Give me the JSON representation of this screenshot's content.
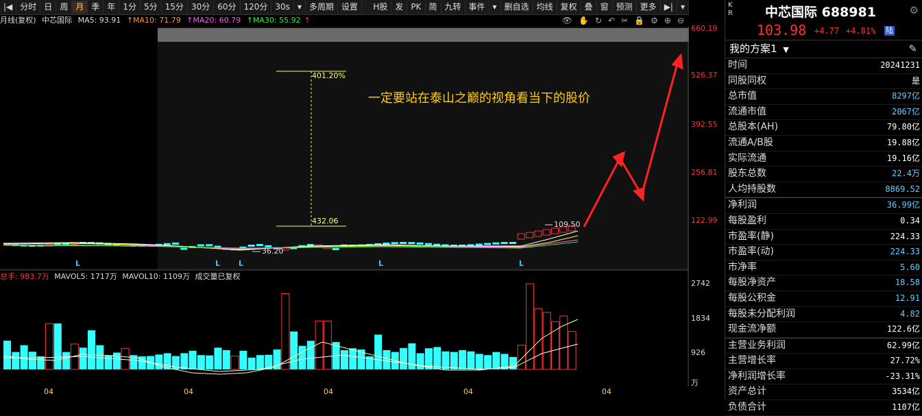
{
  "toolbar": {
    "left_items": [
      "|◀",
      "分时",
      "日",
      "周",
      "月",
      "季",
      "年",
      "1分",
      "5分",
      "15分",
      "30分",
      "60分",
      "120分",
      "30s",
      "▾",
      "多周期",
      "设置"
    ],
    "active_item": "月",
    "right_items": [
      "H股",
      "发",
      "PK",
      "简",
      "九转",
      "事件",
      "▾",
      "删自选",
      "均线",
      "复权",
      "叠",
      "窗",
      "预测",
      "更多",
      "▶|",
      "▾"
    ]
  },
  "info": {
    "period": "月线(复权)",
    "name": "中芯国际",
    "ma5": "MA5: 93.91",
    "ma10": "↑MA10: 71.79",
    "ma20": "↑MA20: 60.79",
    "ma30": "↑MA30: 55.92",
    "arrow": "↑"
  },
  "chart_icons": [
    "eye-icon",
    "hand-icon",
    "refresh-icon",
    "undo-icon",
    "scissors-icon",
    "lock-icon",
    "gear-icon",
    "zoom-in-icon",
    "zoom-out-icon"
  ],
  "price_axis": [
    "660.19",
    "526.37",
    "392.55",
    "256.81",
    "122.99"
  ],
  "annotations": {
    "top_pct": "401.20%",
    "low_val": "432.06",
    "note": "一定要站在泰山之巅的视角看当下的股价",
    "high_label": "109.50",
    "low_label": "36.20",
    "l_marker": "L"
  },
  "volume": {
    "head_total": "总手: 983.7万",
    "mavol5": "MAVOL5: 1717万",
    "mavol10": "MAVOL10: 1109万",
    "note": "成交量已复权",
    "axis": [
      "2742",
      "1834",
      "926",
      "万"
    ]
  },
  "x_axis": [
    "04",
    "04",
    "04",
    "04",
    "04"
  ],
  "chart_data": {
    "type": "bar",
    "title": "中芯国际 月线(复权)",
    "ylabel": "万",
    "volume_values": [
      926,
      560,
      780,
      570,
      420,
      1480,
      1480,
      560,
      820,
      700,
      1260,
      780,
      460,
      540,
      680,
      460,
      420,
      430,
      480,
      520,
      430,
      520,
      600,
      460,
      450,
      700,
      620,
      430,
      600,
      380,
      460,
      470,
      640,
      2440,
      1220,
      760,
      920,
      1560,
      1560,
      880,
      620,
      680,
      640,
      420,
      1120,
      620,
      560,
      690,
      840,
      520,
      680,
      720,
      580,
      560,
      620,
      580,
      500,
      460,
      560,
      500,
      400,
      780,
      2760,
      1960,
      1840,
      1540,
      1720,
      1220
    ],
    "up": [
      false,
      false,
      false,
      false,
      false,
      true,
      false,
      false,
      true,
      false,
      false,
      false,
      false,
      false,
      true,
      false,
      false,
      false,
      false,
      false,
      false,
      false,
      false,
      false,
      false,
      false,
      false,
      true,
      false,
      false,
      false,
      false,
      false,
      true,
      false,
      false,
      false,
      true,
      true,
      false,
      false,
      false,
      false,
      false,
      false,
      false,
      false,
      false,
      false,
      false,
      false,
      false,
      false,
      false,
      false,
      false,
      false,
      false,
      false,
      false,
      false,
      true,
      true,
      true,
      true,
      true,
      true,
      true
    ]
  },
  "panel": {
    "badge_k": "K",
    "badge_r": "R",
    "title": "中芯国际 688981",
    "price": "103.98",
    "change": "+4.77",
    "change_pct": "+4.81%",
    "tag": "陆",
    "plan": "我的方案1",
    "rows": [
      {
        "label": "时间",
        "value": "20241231",
        "cls": ""
      },
      {
        "label": "同股同权",
        "value": "是",
        "cls": ""
      },
      {
        "label": "总市值",
        "value": "8297亿",
        "cls": "blue"
      },
      {
        "label": "流通市值",
        "value": "2067亿",
        "cls": "blue"
      },
      {
        "label": "总股本(AH)",
        "value": "79.80亿",
        "cls": ""
      },
      {
        "label": "流通A/B股",
        "value": "19.88亿",
        "cls": ""
      },
      {
        "label": "实际流通",
        "value": "19.16亿",
        "cls": ""
      },
      {
        "label": "股东总数",
        "value": "22.4万",
        "cls": "blue"
      },
      {
        "label": "人均持股数",
        "value": "8869.52",
        "cls": "blue"
      },
      {
        "label": "净利润",
        "value": "36.99亿",
        "cls": "blue"
      },
      {
        "label": "每股盈利",
        "value": "0.34",
        "cls": ""
      },
      {
        "label": "市盈率(静)",
        "value": "224.33",
        "cls": ""
      },
      {
        "label": "市盈率(动)",
        "value": "224.33",
        "cls": "blue"
      },
      {
        "label": "市净率",
        "value": "5.60",
        "cls": "blue"
      },
      {
        "label": "每股净资产",
        "value": "18.58",
        "cls": "blue"
      },
      {
        "label": "每股公积金",
        "value": "12.91",
        "cls": "blue"
      },
      {
        "label": "每股未分配利润",
        "value": "4.82",
        "cls": "blue"
      },
      {
        "label": "现金流净额",
        "value": "122.6亿",
        "cls": ""
      },
      {
        "label": "主营业务利润",
        "value": "62.99亿",
        "cls": ""
      },
      {
        "label": "主营增长率",
        "value": "27.72%",
        "cls": ""
      },
      {
        "label": "净利润增长率",
        "value": "-23.31%",
        "cls": ""
      },
      {
        "label": "资产总计",
        "value": "3534亿",
        "cls": ""
      },
      {
        "label": "负债合计",
        "value": "1107亿",
        "cls": ""
      }
    ]
  }
}
